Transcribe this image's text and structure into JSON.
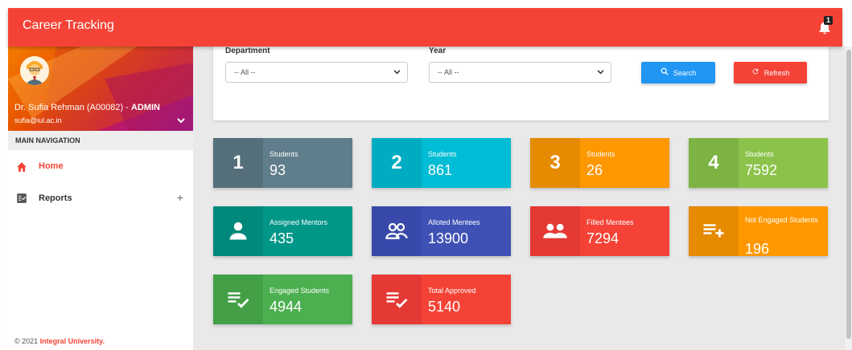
{
  "header": {
    "title": "Career Tracking",
    "notification_count": "1"
  },
  "sidebar": {
    "user": {
      "name": "Dr. Sufia Rehman (A00082) - ",
      "role": "ADMIN",
      "email": "sufia@iul.ac.in"
    },
    "nav_header": "MAIN NAVIGATION",
    "items": [
      {
        "label": "Home",
        "icon": "home-icon",
        "active": true
      },
      {
        "label": "Reports",
        "icon": "reports-icon",
        "expandable": true
      }
    ],
    "footer_prefix": "© 2021 ",
    "footer_org": "Integral University."
  },
  "filters": {
    "department_label": "Department",
    "department_value": "-- All --",
    "year_label": "Year",
    "year_value": "-- All --",
    "search_label": "Search",
    "refresh_label": "Refresh"
  },
  "tiles": [
    {
      "icon_text": "1",
      "label": "Students",
      "value": "93",
      "icon_color": "#546e7a",
      "color": "#607d8b"
    },
    {
      "icon_text": "2",
      "label": "Students",
      "value": "861",
      "icon_color": "#00acc1",
      "color": "#00bcd4"
    },
    {
      "icon_text": "3",
      "label": "Students",
      "value": "26",
      "icon_color": "#e68a00",
      "color": "#ff9800"
    },
    {
      "icon_text": "4",
      "label": "Students",
      "value": "7592",
      "icon_color": "#7cb342",
      "color": "#8bc34a"
    },
    {
      "icon": "person-icon",
      "label": "Assigned Mentors",
      "value": "435",
      "icon_color": "#00897b",
      "color": "#009688"
    },
    {
      "icon": "group-outline-icon",
      "label": "Alloted Mentees",
      "value": "13900",
      "icon_color": "#3949ab",
      "color": "#3f51b5"
    },
    {
      "icon": "group-icon",
      "label": "Filled Mentees",
      "value": "7294",
      "icon_color": "#e53935",
      "color": "#f44336"
    },
    {
      "icon": "playlist-add-icon",
      "label": "Not Engaged Students",
      "value": "196",
      "icon_color": "#e68a00",
      "color": "#ff9800"
    },
    {
      "icon": "playlist-check-icon",
      "label": "Engaged Students",
      "value": "4944",
      "icon_color": "#43a047",
      "color": "#4caf50"
    },
    {
      "icon": "playlist-check-icon",
      "label": "Total Approved",
      "value": "5140",
      "icon_color": "#e53935",
      "color": "#f44336"
    }
  ]
}
